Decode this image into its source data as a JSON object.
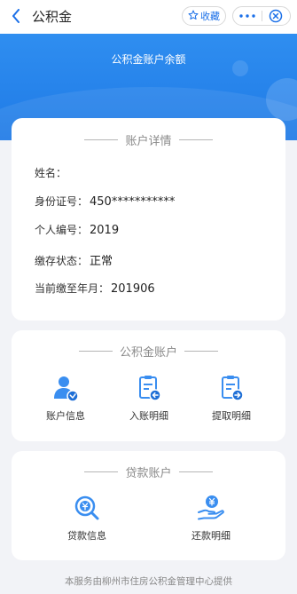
{
  "header": {
    "title": "公积金",
    "favorite_label": "收藏"
  },
  "banner": {
    "title": "公积金账户余额"
  },
  "account_details": {
    "section_title": "账户详情",
    "rows": [
      {
        "label": "姓名：",
        "value": ""
      },
      {
        "label": "身份证号：",
        "value": "450***********"
      },
      {
        "label": "个人编号：",
        "value": "2019"
      },
      {
        "label": "缴存状态：",
        "value": "正常"
      },
      {
        "label": "当前缴至年月：",
        "value": "201906"
      }
    ]
  },
  "fund_account": {
    "section_title": "公积金账户",
    "items": [
      {
        "label": "账户信息",
        "icon": "user-check-icon"
      },
      {
        "label": "入账明细",
        "icon": "document-in-icon"
      },
      {
        "label": "提取明细",
        "icon": "document-out-icon"
      }
    ]
  },
  "loan_account": {
    "section_title": "贷款账户",
    "items": [
      {
        "label": "贷款信息",
        "icon": "search-money-icon"
      },
      {
        "label": "还款明细",
        "icon": "hand-yen-icon"
      }
    ]
  },
  "footer": {
    "text": "本服务由柳州市住房公积金管理中心提供"
  },
  "colors": {
    "accent": "#1a6fe8",
    "banner": "#2f8ef0",
    "icon_blue": "#3a8ef0",
    "background": "#f2f3f7"
  }
}
